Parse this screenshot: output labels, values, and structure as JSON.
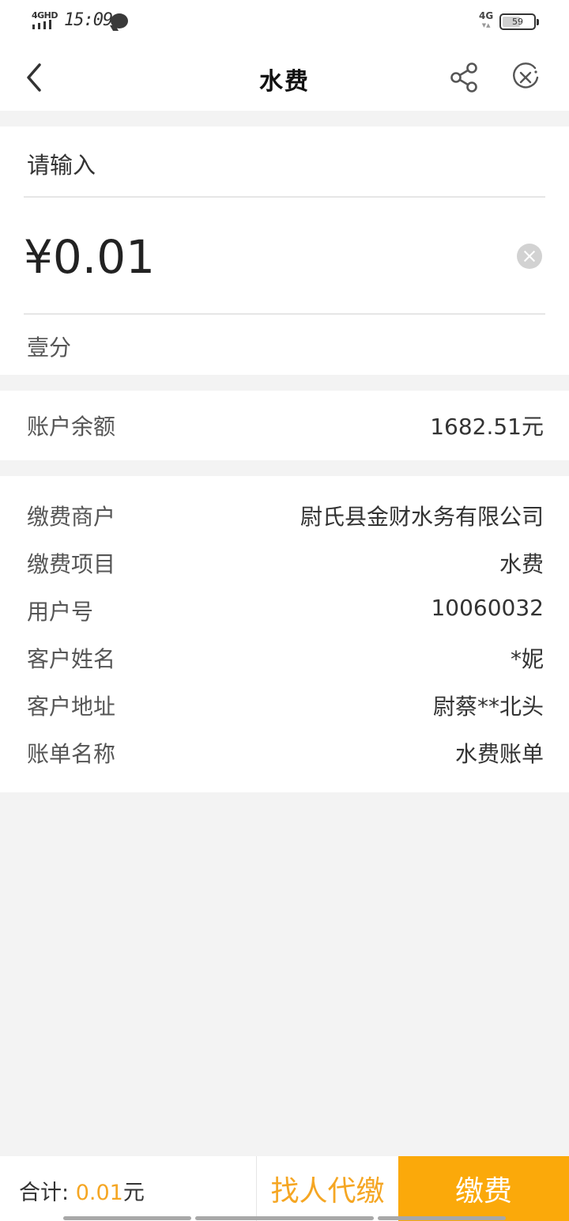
{
  "status_bar": {
    "network_left": "4GHD",
    "time": "15:09",
    "network_right": "4G",
    "battery": "59",
    "battery_level": 0.59
  },
  "nav": {
    "title": "水费",
    "back_icon": "chevron-left-icon",
    "share_icon": "share-icon",
    "close_icon": "close-circle-icon"
  },
  "payment_input": {
    "prompt": "请输入",
    "amount": "¥0.01",
    "amount_in_words": "壹分"
  },
  "balance": {
    "label": "账户余额",
    "value": "1682.51元"
  },
  "details": [
    {
      "label": "缴费商户",
      "value": "尉氏县金财水务有限公司"
    },
    {
      "label": "缴费项目",
      "value": "水费"
    },
    {
      "label": "用户号",
      "value": "10060032"
    },
    {
      "label": "客户姓名",
      "value": "*妮"
    },
    {
      "label": "客户地址",
      "value": "尉蔡**北头"
    },
    {
      "label": "账单名称",
      "value": "水费账单"
    }
  ],
  "bottom_bar": {
    "total_label": "合计:",
    "total_amount": "0.01",
    "total_unit": "元",
    "agent_pay_label": "找人代缴",
    "pay_label": "缴费"
  },
  "colors": {
    "accent": "#fba90a",
    "accent_text": "#f5a623",
    "background": "#f3f3f3"
  }
}
